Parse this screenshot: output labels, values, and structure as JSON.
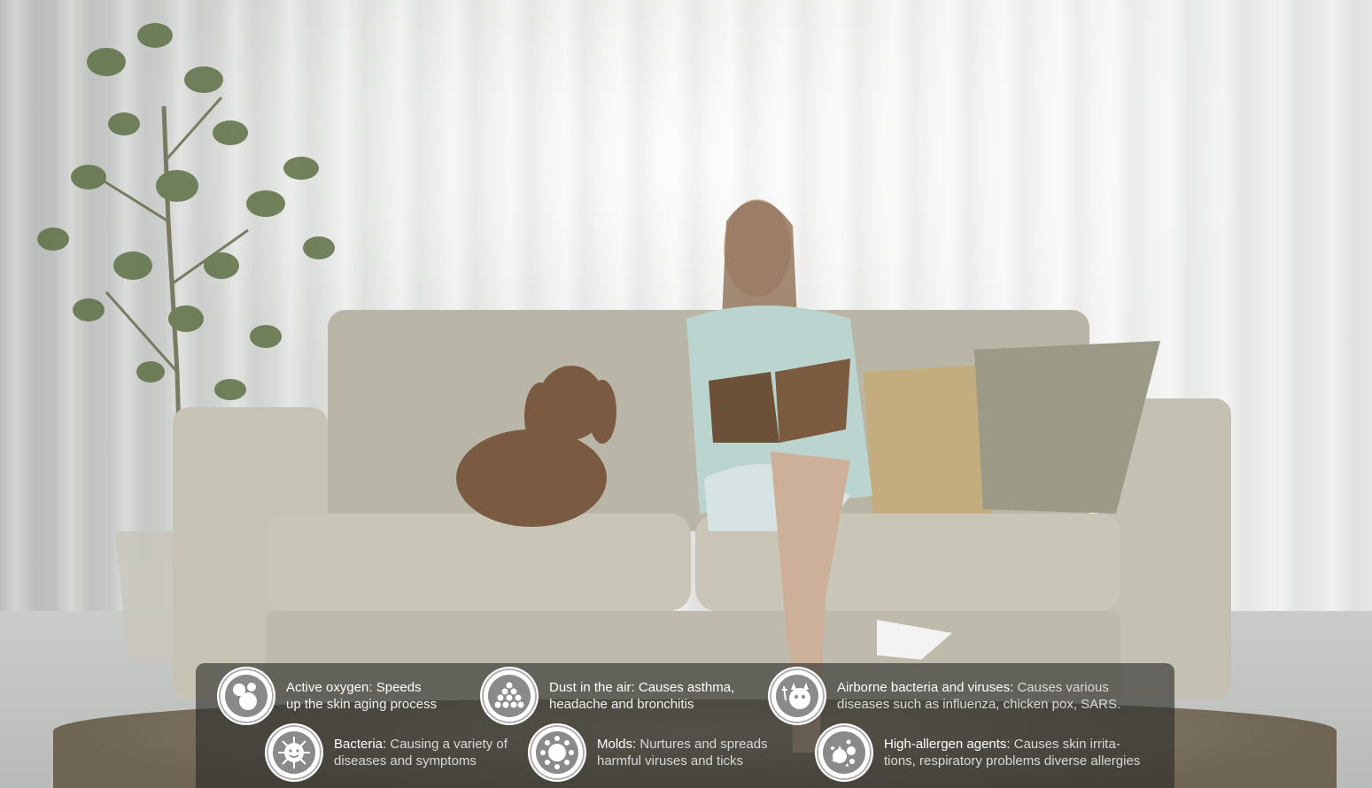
{
  "image": {
    "description_icons": [
      "oxygen-bubbles-icon",
      "dust-particles-icon",
      "virus-devil-icon",
      "bacteria-sun-icon",
      "mold-icon",
      "allergen-splash-icon"
    ]
  },
  "info_items": [
    {
      "icon": "oxygen-bubbles-icon",
      "title": "Active oxygen: Speeds",
      "line2": "up the skin aging process"
    },
    {
      "icon": "dust-particles-icon",
      "title": "Dust in the air: Causes asthma,",
      "line2": "headache and bronchitis"
    },
    {
      "icon": "virus-devil-icon",
      "title": "Airborne bacteria and viruses:",
      "desc": " Causes various",
      "line2": "diseases such as influenza, chicken pox, SARS."
    },
    {
      "icon": "bacteria-sun-icon",
      "title": "Bacteria:",
      "desc": " Causing a variety of",
      "line2": "diseases and symptoms"
    },
    {
      "icon": "mold-icon",
      "title": "Molds:",
      "desc": " Nurtures and spreads",
      "line2": "harmful viruses and ticks"
    },
    {
      "icon": "allergen-splash-icon",
      "title": "High-allergen agents:",
      "desc": " Causes skin irrita-",
      "line2": "tions, respiratory problems diverse allergies"
    }
  ]
}
